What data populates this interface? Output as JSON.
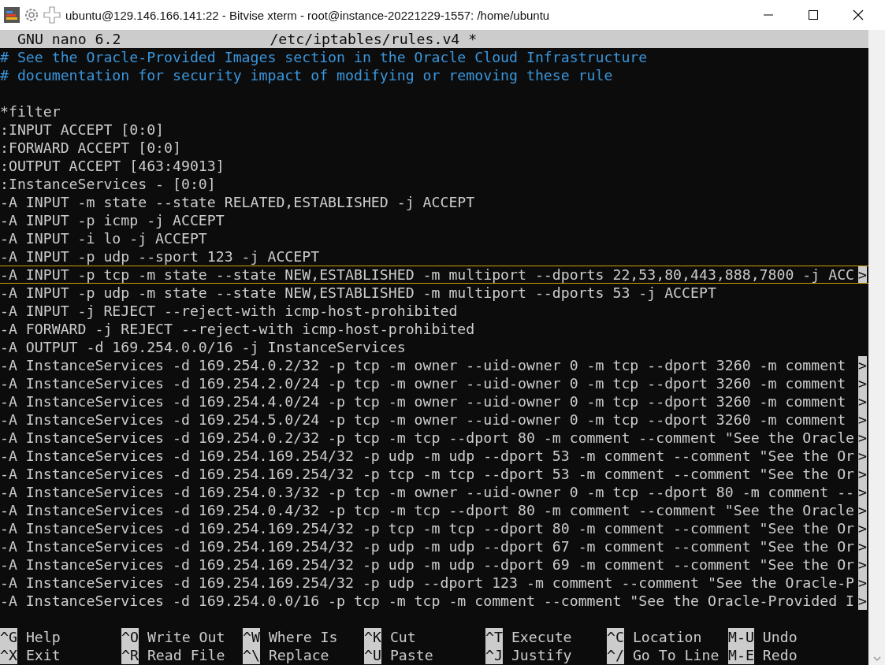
{
  "window": {
    "title": "ubuntu@129.146.166.141:22 - Bitvise xterm - root@instance-20221229-1557: /home/ubuntu"
  },
  "editor": {
    "app": "GNU nano 6.2",
    "file": "/etc/iptables/rules.v4 *"
  },
  "lines": [
    {
      "kind": "comment",
      "text": "# See the Oracle-Provided Images section in the Oracle Cloud Infrastructure",
      "current": false
    },
    {
      "kind": "comment",
      "text": "# documentation for security impact of modifying or removing these rule",
      "current": false
    },
    {
      "kind": "blank"
    },
    {
      "kind": "code",
      "text": "*filter",
      "current": false
    },
    {
      "kind": "code",
      "text": ":INPUT ACCEPT [0:0]",
      "current": false
    },
    {
      "kind": "code",
      "text": ":FORWARD ACCEPT [0:0]",
      "current": false
    },
    {
      "kind": "code",
      "text": ":OUTPUT ACCEPT [463:49013]",
      "current": false
    },
    {
      "kind": "code",
      "text": ":InstanceServices - [0:0]",
      "current": false
    },
    {
      "kind": "code",
      "text": "-A INPUT -m state --state RELATED,ESTABLISHED -j ACCEPT",
      "current": false
    },
    {
      "kind": "code",
      "text": "-A INPUT -p icmp -j ACCEPT",
      "current": false
    },
    {
      "kind": "code",
      "text": "-A INPUT -i lo -j ACCEPT",
      "current": false
    },
    {
      "kind": "code",
      "text": "-A INPUT -p udp --sport 123 -j ACCEPT",
      "current": false
    },
    {
      "kind": "code",
      "text": "-A INPUT -p tcp -m state --state NEW,ESTABLISHED -m multiport --dports 22,53,80,443,888,7800 -j ACC",
      "current": true,
      "overflow": ">"
    },
    {
      "kind": "code",
      "text": "-A INPUT -p udp -m state --state NEW,ESTABLISHED -m multiport --dports 53 -j ACCEPT",
      "current": false
    },
    {
      "kind": "code",
      "text": "-A INPUT -j REJECT --reject-with icmp-host-prohibited",
      "current": false
    },
    {
      "kind": "code",
      "text": "-A FORWARD -j REJECT --reject-with icmp-host-prohibited",
      "current": false
    },
    {
      "kind": "code",
      "text": "-A OUTPUT -d 169.254.0.0/16 -j InstanceServices",
      "current": false
    },
    {
      "kind": "code",
      "text": "-A InstanceServices -d 169.254.0.2/32 -p tcp -m owner --uid-owner 0 -m tcp --dport 3260 -m comment",
      "current": false,
      "overflow": ">"
    },
    {
      "kind": "code",
      "text": "-A InstanceServices -d 169.254.2.0/24 -p tcp -m owner --uid-owner 0 -m tcp --dport 3260 -m comment",
      "current": false,
      "overflow": ">"
    },
    {
      "kind": "code",
      "text": "-A InstanceServices -d 169.254.4.0/24 -p tcp -m owner --uid-owner 0 -m tcp --dport 3260 -m comment",
      "current": false,
      "overflow": ">"
    },
    {
      "kind": "code",
      "text": "-A InstanceServices -d 169.254.5.0/24 -p tcp -m owner --uid-owner 0 -m tcp --dport 3260 -m comment",
      "current": false,
      "overflow": ">"
    },
    {
      "kind": "code",
      "text": "-A InstanceServices -d 169.254.0.2/32 -p tcp -m tcp --dport 80 -m comment --comment \"See the Oracle",
      "current": false,
      "overflow": ">"
    },
    {
      "kind": "code",
      "text": "-A InstanceServices -d 169.254.169.254/32 -p udp -m udp --dport 53 -m comment --comment \"See the Or",
      "current": false,
      "overflow": ">"
    },
    {
      "kind": "code",
      "text": "-A InstanceServices -d 169.254.169.254/32 -p tcp -m tcp --dport 53 -m comment --comment \"See the Or",
      "current": false,
      "overflow": ">"
    },
    {
      "kind": "code",
      "text": "-A InstanceServices -d 169.254.0.3/32 -p tcp -m owner --uid-owner 0 -m tcp --dport 80 -m comment --",
      "current": false,
      "overflow": ">"
    },
    {
      "kind": "code",
      "text": "-A InstanceServices -d 169.254.0.4/32 -p tcp -m tcp --dport 80 -m comment --comment \"See the Oracle",
      "current": false,
      "overflow": ">"
    },
    {
      "kind": "code",
      "text": "-A InstanceServices -d 169.254.169.254/32 -p tcp -m tcp --dport 80 -m comment --comment \"See the Or",
      "current": false,
      "overflow": ">"
    },
    {
      "kind": "code",
      "text": "-A InstanceServices -d 169.254.169.254/32 -p udp -m udp --dport 67 -m comment --comment \"See the Or",
      "current": false,
      "overflow": ">"
    },
    {
      "kind": "code",
      "text": "-A InstanceServices -d 169.254.169.254/32 -p udp -m udp --dport 69 -m comment --comment \"See the Or",
      "current": false,
      "overflow": ">"
    },
    {
      "kind": "code",
      "text": "-A InstanceServices -d 169.254.169.254/32 -p udp --dport 123 -m comment --comment \"See the Oracle-P",
      "current": false,
      "overflow": ">"
    },
    {
      "kind": "code",
      "text": "-A InstanceServices -d 169.254.0.0/16 -p tcp -m tcp -m comment --comment \"See the Oracle-Provided I",
      "current": false,
      "overflow": ">"
    }
  ],
  "shortcuts": [
    [
      {
        "key": "^G",
        "label": "Help"
      },
      {
        "key": "^O",
        "label": "Write Out"
      },
      {
        "key": "^W",
        "label": "Where Is"
      },
      {
        "key": "^K",
        "label": "Cut"
      },
      {
        "key": "^T",
        "label": "Execute"
      },
      {
        "key": "^C",
        "label": "Location"
      },
      {
        "key": "M-U",
        "label": "Undo"
      }
    ],
    [
      {
        "key": "^X",
        "label": "Exit"
      },
      {
        "key": "^R",
        "label": "Read File"
      },
      {
        "key": "^\\",
        "label": "Replace"
      },
      {
        "key": "^U",
        "label": "Paste"
      },
      {
        "key": "^J",
        "label": "Justify"
      },
      {
        "key": "^/",
        "label": "Go To Line"
      },
      {
        "key": "M-E",
        "label": "Redo"
      }
    ]
  ]
}
